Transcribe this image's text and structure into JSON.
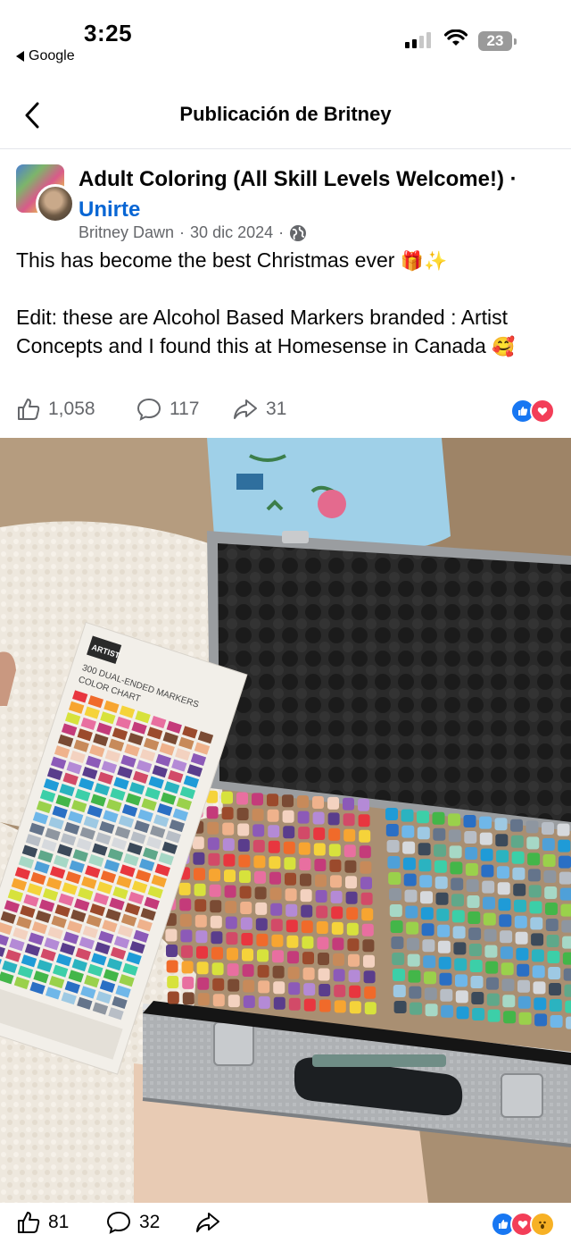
{
  "status_bar": {
    "time": "3:25",
    "back_app": "Google",
    "battery": "23"
  },
  "nav": {
    "title": "Publicación de Britney"
  },
  "post": {
    "group_name": "Adult Coloring (All Skill Levels Welcome!)",
    "separator": "·",
    "join": "Unirte",
    "author": "Britney Dawn",
    "date": "30 dic 2024",
    "dot": "·",
    "text_line1": "This has become the best Christmas ever",
    "text_line1_emoji": "🎁✨",
    "text_line2": "Edit: these are Alcohol Based Markers branded : Artist Concepts and I found this at Homesense in Canada",
    "text_line2_emoji": "🥰",
    "likes": "1,058",
    "comments": "117",
    "shares": "31"
  },
  "photo": {
    "chart_brand": "ARTIST",
    "chart_title_line1": "300 DUAL-ENDED MARKERS",
    "chart_title_line2": "COLOR CHART"
  },
  "bottom": {
    "likes": "81",
    "comments": "32"
  },
  "colors": {
    "link_blue": "#0866d4",
    "like_blue": "#1877f2",
    "love_red": "#f33e58",
    "wow_yellow": "#f7b125",
    "meta_gray": "#65676b"
  },
  "icons": [
    "back-arrow-icon",
    "wifi-icon",
    "globe-icon",
    "like-icon",
    "comment-icon",
    "share-icon",
    "like-reaction-icon",
    "love-reaction-icon",
    "wow-reaction-icon"
  ]
}
